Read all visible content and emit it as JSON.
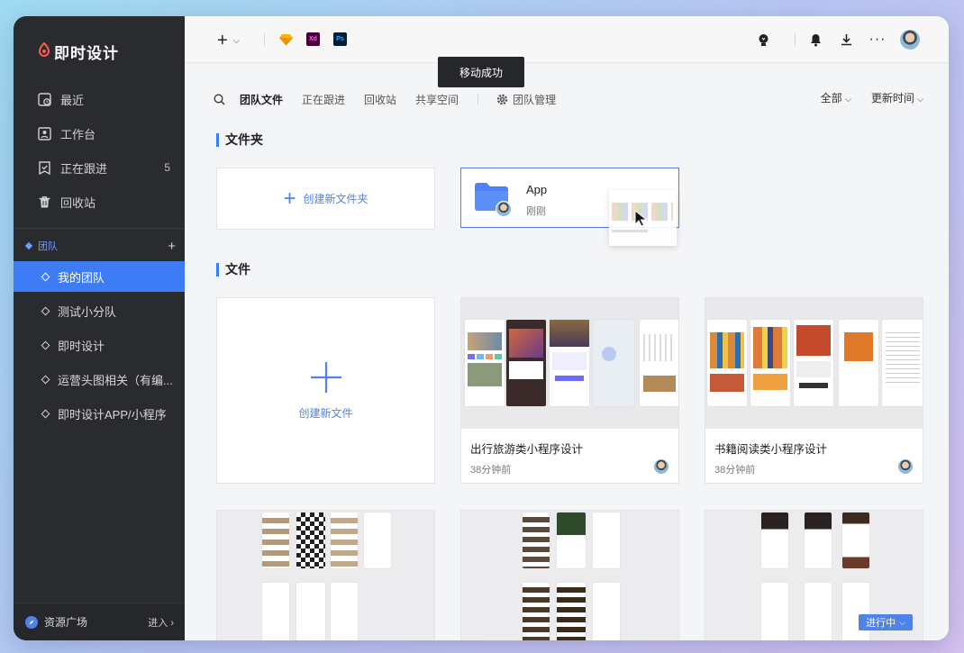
{
  "app": {
    "name": "即时设计"
  },
  "sidebar": {
    "items": [
      {
        "label": "最近",
        "icon": "clock-icon"
      },
      {
        "label": "工作台",
        "icon": "workbench-icon"
      },
      {
        "label": "正在跟进",
        "icon": "bookmark-icon",
        "count": "5"
      },
      {
        "label": "回收站",
        "icon": "trash-icon"
      }
    ],
    "team_header": "团队",
    "teams": [
      {
        "label": "我的团队",
        "active": true
      },
      {
        "label": "测试小分队"
      },
      {
        "label": "即时设计"
      },
      {
        "label": "运营头图相关（有编..."
      },
      {
        "label": "即时设计APP/小程序"
      }
    ],
    "footer": {
      "label": "资源广场",
      "action": "进入"
    }
  },
  "topbar": {
    "apps": [
      "sketch-icon",
      "xd-icon",
      "ps-icon"
    ],
    "xd_label": "Xd",
    "ps_label": "Ps",
    "right_icons": [
      "bulb-icon",
      "bell-icon",
      "download-icon",
      "more-icon",
      "avatar"
    ]
  },
  "toast": "移动成功",
  "tabs": [
    "团队文件",
    "正在跟进",
    "回收站",
    "共享空间"
  ],
  "team_manage": "团队管理",
  "filters": {
    "all": "全部",
    "sort": "更新时间"
  },
  "sections": {
    "folders": "文件夹",
    "files": "文件"
  },
  "new_folder": "创建新文件夹",
  "folder": {
    "name": "App",
    "time": "刚刚"
  },
  "new_file": "创建新文件",
  "files": [
    {
      "title": "出行旅游类小程序设计",
      "time": "38分钟前"
    },
    {
      "title": "书籍阅读类小程序设计",
      "time": "38分钟前"
    }
  ],
  "status_badge": "进行中",
  "colors": {
    "accent": "#3d7cf5",
    "sidebar": "#2a2b2f"
  }
}
